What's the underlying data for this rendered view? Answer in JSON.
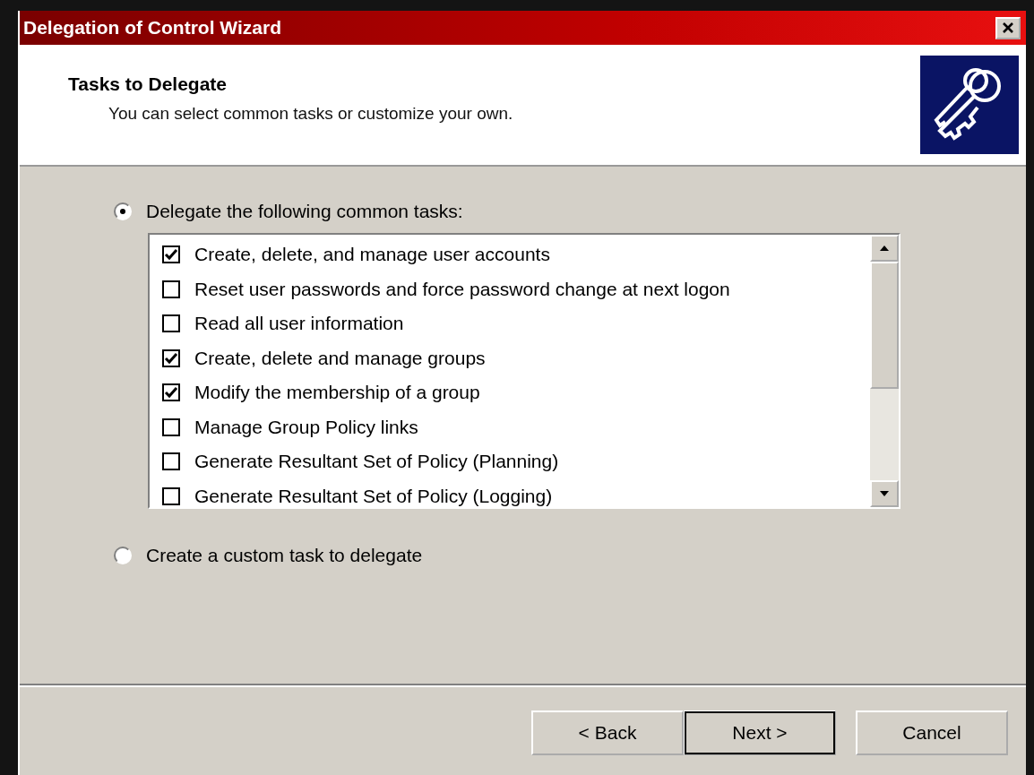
{
  "window": {
    "title": "Delegation of Control Wizard"
  },
  "header": {
    "title": "Tasks to Delegate",
    "subtitle": "You can select common tasks or customize your own."
  },
  "options": [
    {
      "label": "Delegate the following common tasks:",
      "selected": true
    },
    {
      "label": "Create a custom task to delegate",
      "selected": false
    }
  ],
  "tasks": [
    {
      "label": "Create, delete, and manage user accounts",
      "checked": true
    },
    {
      "label": "Reset user passwords and force password change at next logon",
      "checked": false
    },
    {
      "label": "Read all user information",
      "checked": false
    },
    {
      "label": "Create, delete and manage groups",
      "checked": true
    },
    {
      "label": "Modify the membership of a group",
      "checked": true
    },
    {
      "label": "Manage Group Policy links",
      "checked": false
    },
    {
      "label": "Generate Resultant Set of Policy (Planning)",
      "checked": false
    },
    {
      "label": "Generate Resultant Set of Policy (Logging)",
      "checked": false
    }
  ],
  "buttons": [
    {
      "label": "< Back",
      "kind": "normal"
    },
    {
      "label": "Next >",
      "kind": "default"
    },
    {
      "label": "Cancel",
      "kind": "normal"
    }
  ]
}
